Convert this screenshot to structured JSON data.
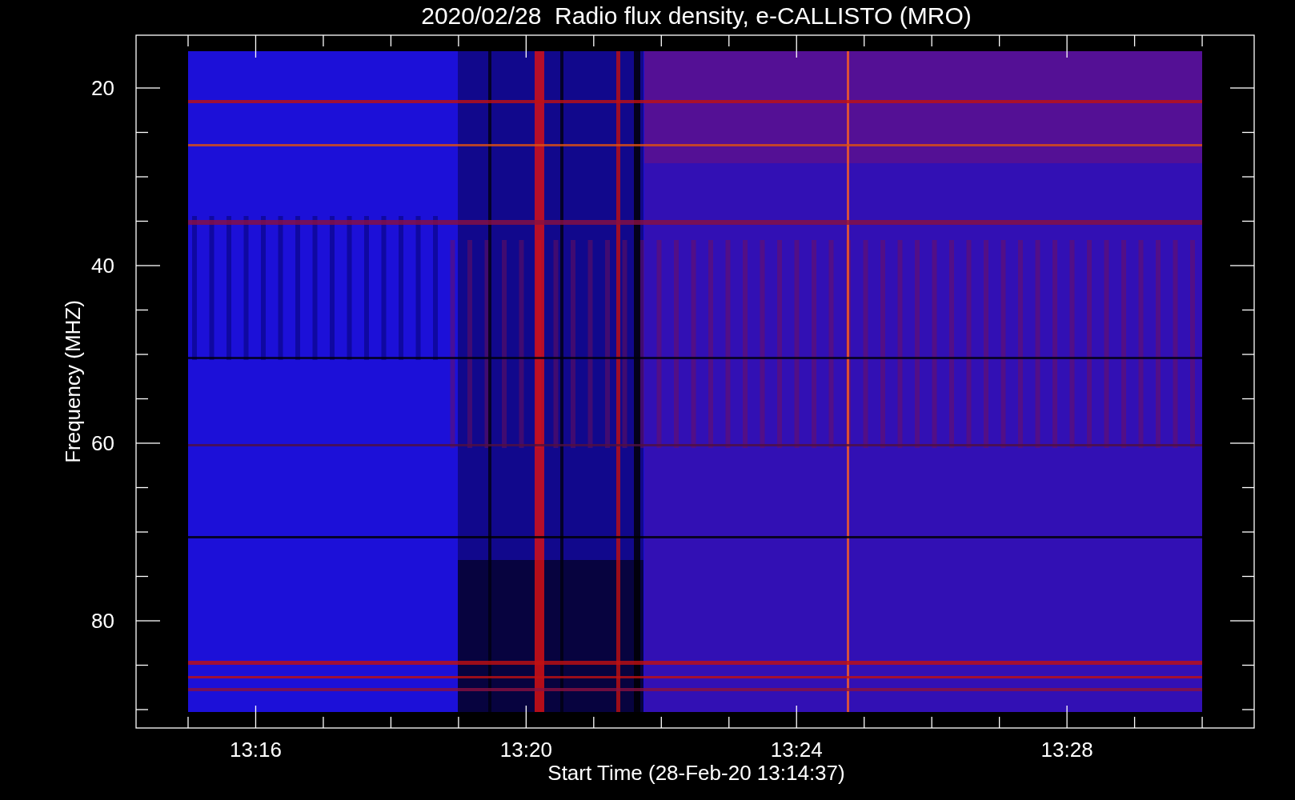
{
  "title": "2020/02/28  Radio flux density, e-CALLISTO (MRO)",
  "y_axis": {
    "label": "Frequency (MHZ)",
    "ticks": [
      "20",
      "40",
      "60",
      "80"
    ]
  },
  "x_axis": {
    "label": "Start Time (28-Feb-20 13:14:37)",
    "ticks": [
      "13:16",
      "13:20",
      "13:24",
      "13:28"
    ]
  }
}
